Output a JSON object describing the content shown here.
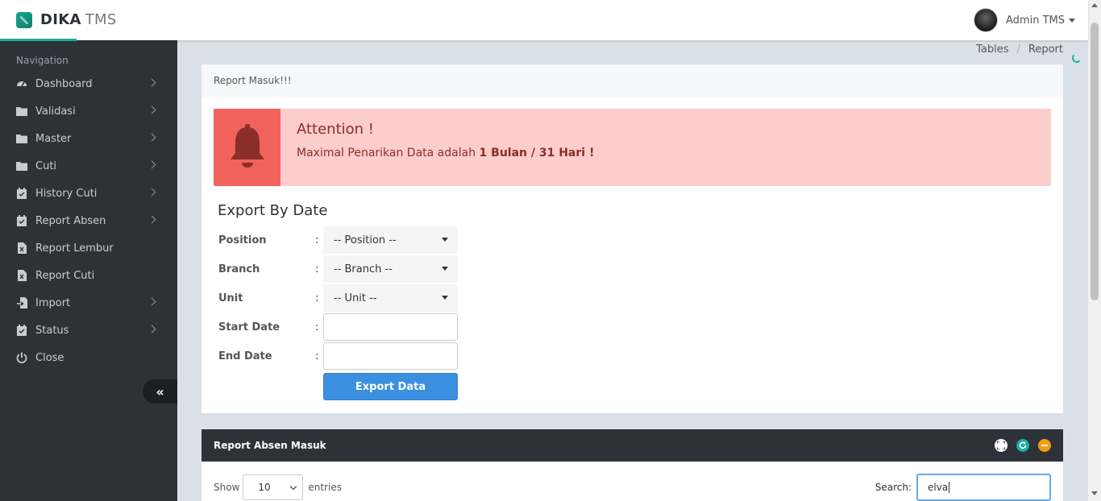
{
  "brand": {
    "name": "DIKA",
    "suffix": "TMS",
    "accent": "#1caf9a"
  },
  "user": {
    "name": "Admin TMS"
  },
  "sidebar": {
    "heading": "Navigation",
    "items": [
      {
        "label": "Dashboard",
        "icon": "dashboard-icon",
        "has_children": true
      },
      {
        "label": "Validasi",
        "icon": "folder-icon",
        "has_children": true
      },
      {
        "label": "Master",
        "icon": "folder-icon",
        "has_children": true
      },
      {
        "label": "Cuti",
        "icon": "folder-icon",
        "has_children": true
      },
      {
        "label": "History Cuti",
        "icon": "calendar-check-icon",
        "has_children": true
      },
      {
        "label": "Report Absen",
        "icon": "calendar-check-icon",
        "has_children": true
      },
      {
        "label": "Report Lembur",
        "icon": "excel-file-icon",
        "has_children": false
      },
      {
        "label": "Report Cuti",
        "icon": "excel-file-icon",
        "has_children": false
      },
      {
        "label": "Import",
        "icon": "import-icon",
        "has_children": true
      },
      {
        "label": "Status",
        "icon": "calendar-check-icon",
        "has_children": true
      },
      {
        "label": "Close",
        "icon": "power-icon",
        "has_children": false
      }
    ],
    "collapse_icon": "double-chevron-left-icon"
  },
  "breadcrumb": [
    "Tables",
    "Report"
  ],
  "report_panel": {
    "title": "Report Masuk!!!",
    "alert": {
      "title": "Attention !",
      "text": "Maximal Penarikan Data adalah ",
      "highlight": "1 Bulan / 31 Hari !",
      "icon": "bell-icon",
      "bg": "#fdcdcc",
      "icon_bg": "#f2625d"
    },
    "export_title": "Export By Date",
    "fields": {
      "position": {
        "label": "Position",
        "value": "-- Position --"
      },
      "branch": {
        "label": "Branch",
        "value": "-- Branch --"
      },
      "unit": {
        "label": "Unit",
        "value": "-- Unit --"
      },
      "start_date": {
        "label": "Start Date",
        "value": ""
      },
      "end_date": {
        "label": "End Date",
        "value": ""
      }
    },
    "colon": ":",
    "export_button": "Export Data"
  },
  "table_panel": {
    "title": "Report Absen Masuk",
    "tools": [
      "expand-icon",
      "refresh-icon",
      "minimize-icon"
    ],
    "show_label": "Show",
    "page_length": "10",
    "entries_label": "entries",
    "search_label": "Search:",
    "search_value": "elva"
  }
}
